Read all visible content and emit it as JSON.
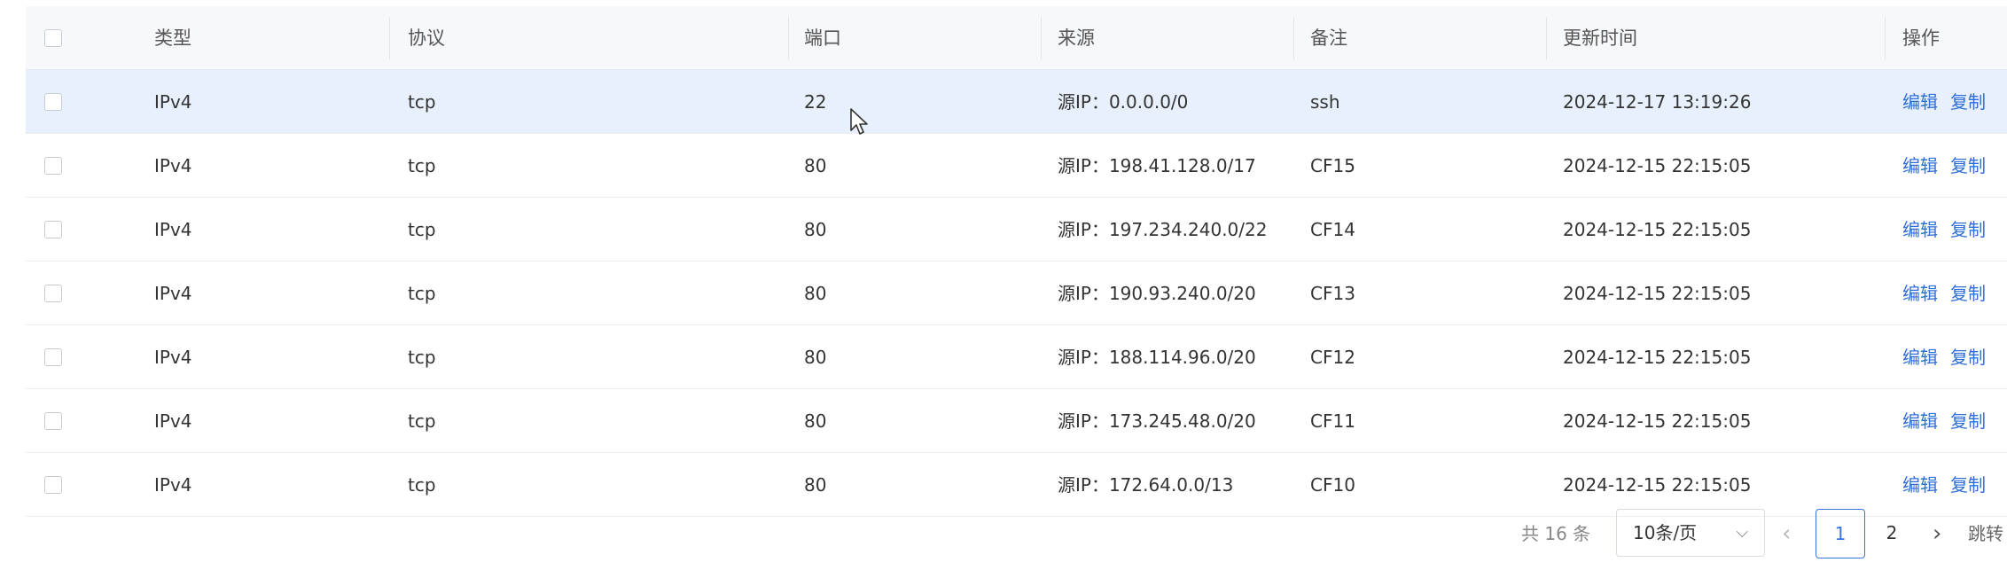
{
  "table": {
    "headers": [
      "类型",
      "协议",
      "端口",
      "来源",
      "备注",
      "更新时间",
      "操作"
    ],
    "rows": [
      {
        "type": "IPv4",
        "protocol": "tcp",
        "port": "22",
        "source": "源IP：0.0.0.0/0",
        "note": "ssh",
        "updated": "2024-12-17 13:19:26"
      },
      {
        "type": "IPv4",
        "protocol": "tcp",
        "port": "80",
        "source": "源IP：198.41.128.0/17",
        "note": "CF15",
        "updated": "2024-12-15 22:15:05"
      },
      {
        "type": "IPv4",
        "protocol": "tcp",
        "port": "80",
        "source": "源IP：197.234.240.0/22",
        "note": "CF14",
        "updated": "2024-12-15 22:15:05"
      },
      {
        "type": "IPv4",
        "protocol": "tcp",
        "port": "80",
        "source": "源IP：190.93.240.0/20",
        "note": "CF13",
        "updated": "2024-12-15 22:15:05"
      },
      {
        "type": "IPv4",
        "protocol": "tcp",
        "port": "80",
        "source": "源IP：188.114.96.0/20",
        "note": "CF12",
        "updated": "2024-12-15 22:15:05"
      },
      {
        "type": "IPv4",
        "protocol": "tcp",
        "port": "80",
        "source": "源IP：173.245.48.0/20",
        "note": "CF11",
        "updated": "2024-12-15 22:15:05"
      },
      {
        "type": "IPv4",
        "protocol": "tcp",
        "port": "80",
        "source": "源IP：172.64.0.0/13",
        "note": "CF10",
        "updated": "2024-12-15 22:15:05"
      }
    ],
    "actions": {
      "edit": "编辑",
      "copy": "复制"
    },
    "selected_row_index": 0
  },
  "pagination": {
    "total": "共 16 条",
    "page_size": "10条/页",
    "pages": [
      "1",
      "2"
    ],
    "current_page": "1",
    "jump_label": "跳转"
  },
  "colors": {
    "link": "#2f6fd6",
    "selected_row": "#e8f0fd",
    "header_bg": "#f7f8fa"
  }
}
